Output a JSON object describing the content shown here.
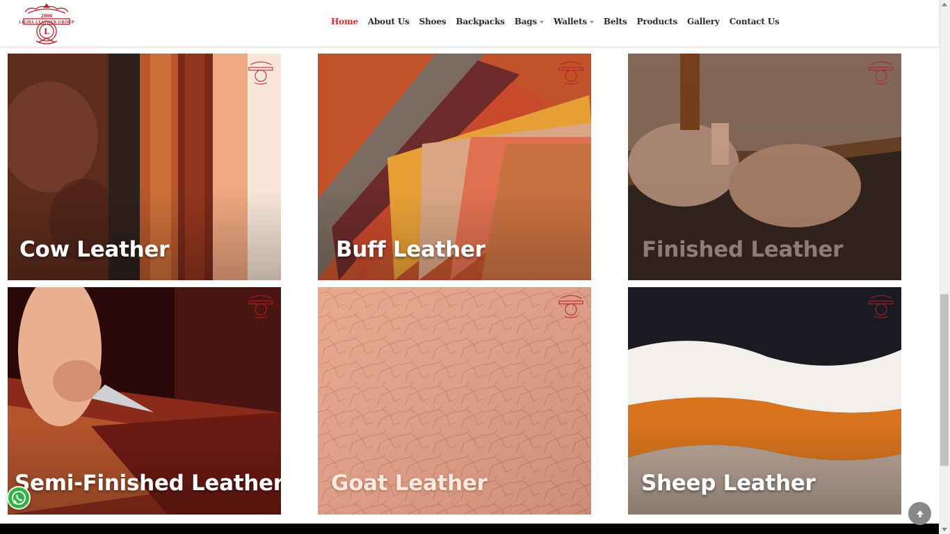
{
  "brand": {
    "logo_top": "2006",
    "logo_text": "LIGMA LEATHER GROUP",
    "logo_letter": "L",
    "accent": "#b3202a"
  },
  "nav": [
    {
      "label": "Home",
      "active": true,
      "dropdown": false
    },
    {
      "label": "About Us",
      "active": false,
      "dropdown": false
    },
    {
      "label": "Shoes",
      "active": false,
      "dropdown": false
    },
    {
      "label": "Backpacks",
      "active": false,
      "dropdown": false
    },
    {
      "label": "Bags",
      "active": false,
      "dropdown": true
    },
    {
      "label": "Wallets",
      "active": false,
      "dropdown": true
    },
    {
      "label": "Belts",
      "active": false,
      "dropdown": false
    },
    {
      "label": "Products",
      "active": false,
      "dropdown": false
    },
    {
      "label": "Gallery",
      "active": false,
      "dropdown": false
    },
    {
      "label": "Contact Us",
      "active": false,
      "dropdown": false
    }
  ],
  "cards": [
    {
      "title": "Cow Leather"
    },
    {
      "title": "Buff Leather"
    },
    {
      "title": "Finished Leather"
    },
    {
      "title": "Semi-Finished Leather"
    },
    {
      "title": "Goat Leather"
    },
    {
      "title": "Sheep Leather"
    }
  ],
  "icons": {
    "whatsapp": "whatsapp-icon",
    "back_to_top": "arrow-up-icon"
  },
  "colors": {
    "nav_active": "#d32f2f",
    "nav_text": "#2b2b2b",
    "whatsapp": "#2fb344"
  }
}
